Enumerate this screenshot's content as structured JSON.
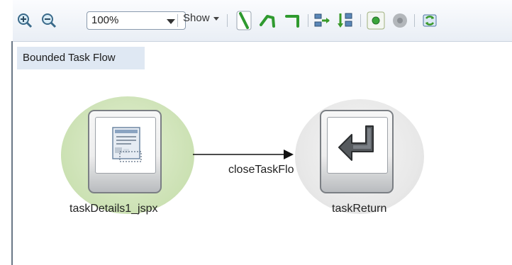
{
  "toolbar": {
    "zoom_value": "100%",
    "show_label": "Show",
    "icons": [
      "zoom-in-icon",
      "zoom-out-icon",
      "line-straight-icon",
      "line-elbow-icon",
      "line-elbow-alt-icon",
      "layout-horizontal-icon",
      "layout-vertical-icon",
      "green-dot-icon",
      "grey-dot-icon",
      "refresh-icon"
    ]
  },
  "canvas": {
    "title": "Bounded Task Flow",
    "nodes": [
      {
        "name": "taskDetails1_jspx",
        "icon": "jspx-page-icon",
        "halo_color": "#cfe3b8"
      },
      {
        "name": "taskReturn",
        "icon": "return-arrow-icon",
        "halo_color": "#e9e9e9"
      }
    ],
    "edge": {
      "label": "closeTaskFlo"
    }
  }
}
